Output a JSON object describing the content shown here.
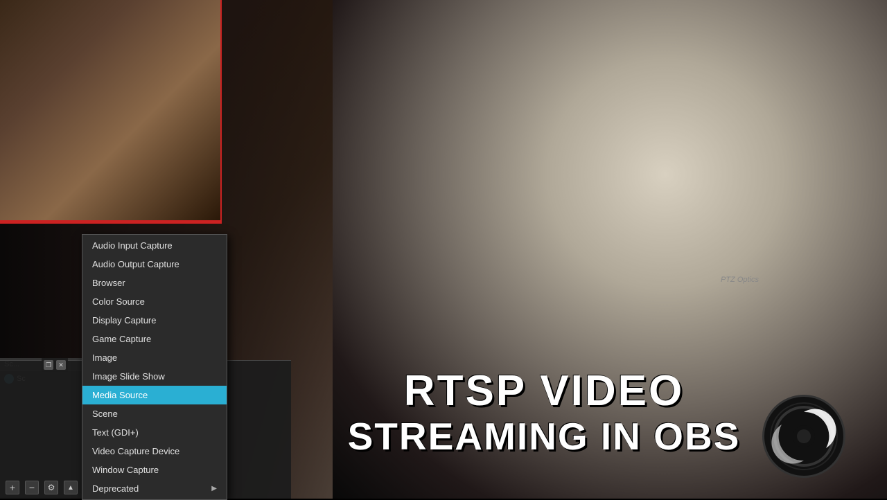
{
  "app": {
    "title": "OBS Studio"
  },
  "video_bg": {
    "description": "Camera setup background"
  },
  "title_overlay": {
    "line1": "RTSP VIDEO",
    "line2": "STREAMING IN OBS"
  },
  "context_menu": {
    "items": [
      {
        "id": "audio-input-capture",
        "label": "Audio Input Capture",
        "highlighted": false,
        "has_arrow": false
      },
      {
        "id": "audio-output-capture",
        "label": "Audio Output Capture",
        "highlighted": false,
        "has_arrow": false
      },
      {
        "id": "browser",
        "label": "Browser",
        "highlighted": false,
        "has_arrow": false
      },
      {
        "id": "color-source",
        "label": "Color Source",
        "highlighted": false,
        "has_arrow": false
      },
      {
        "id": "display-capture",
        "label": "Display Capture",
        "highlighted": false,
        "has_arrow": false
      },
      {
        "id": "game-capture",
        "label": "Game Capture",
        "highlighted": false,
        "has_arrow": false
      },
      {
        "id": "image",
        "label": "Image",
        "highlighted": false,
        "has_arrow": false
      },
      {
        "id": "image-slide-show",
        "label": "Image Slide Show",
        "highlighted": false,
        "has_arrow": false
      },
      {
        "id": "media-source",
        "label": "Media Source",
        "highlighted": true,
        "has_arrow": false
      },
      {
        "id": "scene",
        "label": "Scene",
        "highlighted": false,
        "has_arrow": false
      },
      {
        "id": "text-gdip",
        "label": "Text (GDI+)",
        "highlighted": false,
        "has_arrow": false
      },
      {
        "id": "video-capture-device",
        "label": "Video Capture Device",
        "highlighted": false,
        "has_arrow": false
      },
      {
        "id": "window-capture",
        "label": "Window Capture",
        "highlighted": false,
        "has_arrow": false
      },
      {
        "id": "deprecated",
        "label": "Deprecated",
        "highlighted": false,
        "has_arrow": true
      }
    ]
  },
  "scene_panel": {
    "header": "Sc...",
    "item_label": "Sc"
  },
  "bottom_toolbar": {
    "add_label": "+",
    "remove_label": "−",
    "settings_label": "⚙",
    "up_label": "▲",
    "down_label": "▼"
  },
  "window_controls": {
    "restore_label": "❐",
    "close_label": "✕"
  },
  "colors": {
    "accent": "#2aafd3",
    "border_red": "#cc2222",
    "menu_bg": "#2b2b2b",
    "highlight": "#2aafd3"
  }
}
